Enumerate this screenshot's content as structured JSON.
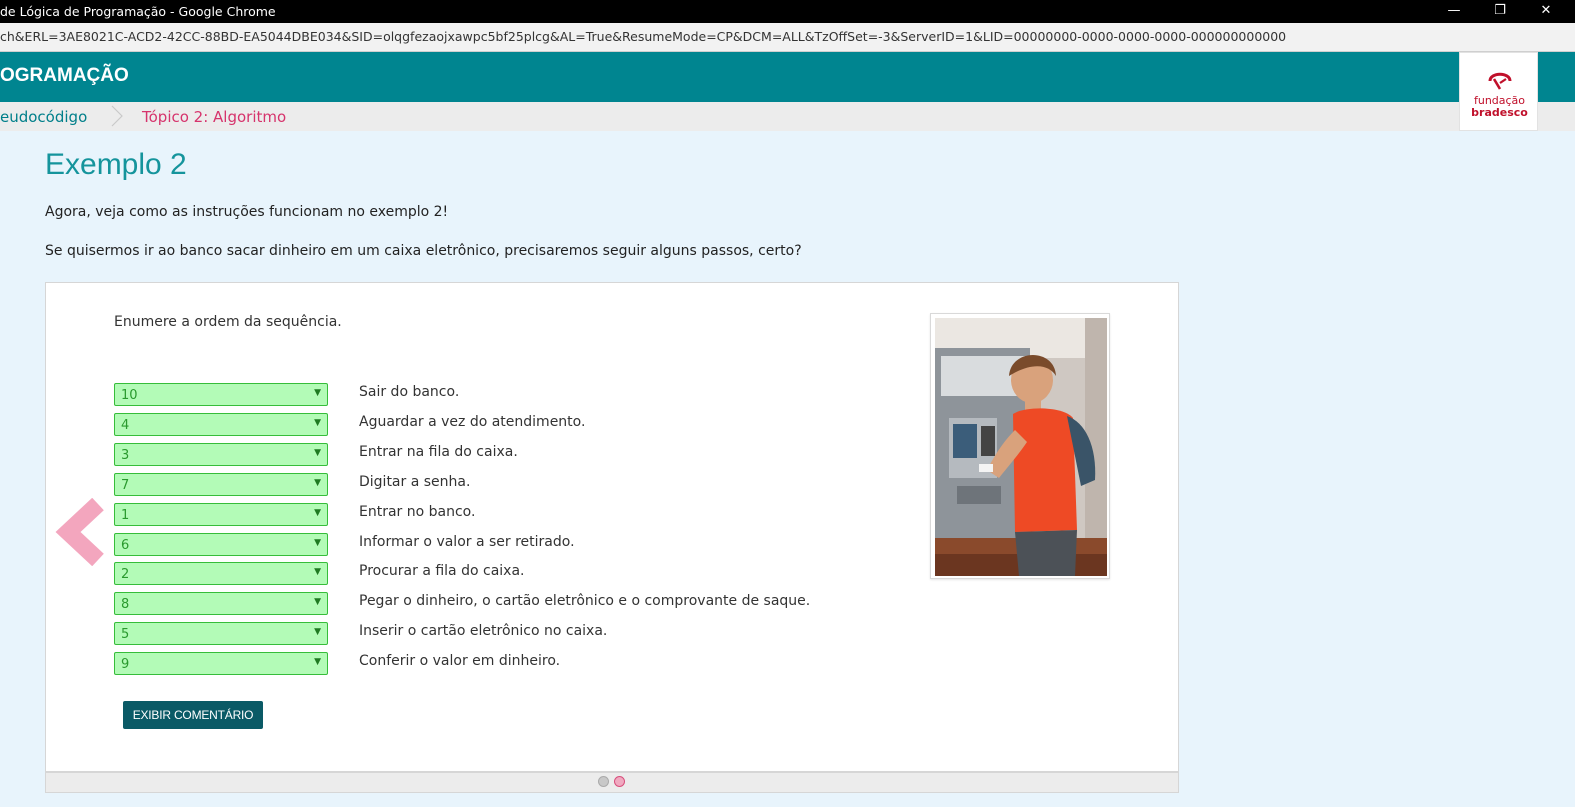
{
  "window": {
    "title": "de Lógica de Programação - Google Chrome",
    "minimize_glyph": "—",
    "restore_glyph": "❐",
    "close_glyph": "✕"
  },
  "address": {
    "url": "ch&ERL=3AE8021C-ACD2-42CC-88BD-EA5044DBE034&SID=olqgfezaojxawpc5bf25plcg&AL=True&ResumeMode=CP&DCM=ALL&TzOffSet=-3&ServerID=1&LID=00000000-0000-0000-0000-000000000000"
  },
  "header": {
    "course_title": "OGRAMAÇÃO",
    "logo_line1": "fundação",
    "logo_line2": "bradesco"
  },
  "breadcrumb": {
    "item1": "eudocódigo",
    "item2": "Tópico 2: Algoritmo"
  },
  "content": {
    "title": "Exemplo 2",
    "intro1": "Agora, veja como as instruções funcionam no exemplo 2!",
    "intro2": "Se quisermos ir ao banco sacar dinheiro em um caixa eletrônico, precisaremos seguir alguns passos, certo?",
    "instruction": "Enumere a ordem da sequência.",
    "steps": [
      {
        "value": "10",
        "text": "Sair do banco."
      },
      {
        "value": "4",
        "text": "Aguardar a vez do atendimento."
      },
      {
        "value": "3",
        "text": "Entrar na fila do caixa."
      },
      {
        "value": "7",
        "text": "Digitar a senha."
      },
      {
        "value": "1",
        "text": "Entrar no banco."
      },
      {
        "value": "6",
        "text": "Informar o valor a ser retirado."
      },
      {
        "value": "2",
        "text": "Procurar a fila do caixa."
      },
      {
        "value": "8",
        "text": "Pegar o dinheiro, o cartão eletrônico e o comprovante de saque."
      },
      {
        "value": "5",
        "text": "Inserir o cartão eletrônico no caixa."
      },
      {
        "value": "9",
        "text": "Conferir o valor em dinheiro."
      }
    ],
    "dropdown_arrow": "▼",
    "button_label": "EXIBIR COMENTÁRIO"
  },
  "pagination": {
    "total": 2,
    "current": 2
  },
  "colors": {
    "header_teal": "#008590",
    "accent_pink": "#d6336c",
    "select_green": "#b3fbb7",
    "button": "#0a5a66",
    "brand_red": "#c0102b"
  }
}
